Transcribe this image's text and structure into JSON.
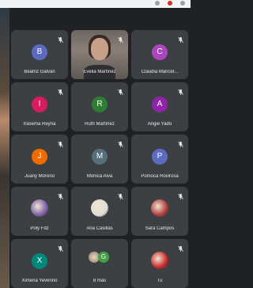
{
  "participants": [
    {
      "name": "Beatriz Galvan",
      "initial": "B",
      "color": "#5c6bc0",
      "muted": true,
      "kind": "letter"
    },
    {
      "name": "Evelia Martínez",
      "initial": "",
      "color": "",
      "muted": true,
      "kind": "video"
    },
    {
      "name": "Claudia Maricel...",
      "initial": "C",
      "color": "#ab47bc",
      "muted": true,
      "kind": "letter"
    },
    {
      "name": "Irasema Reyna",
      "initial": "I",
      "color": "#d81b60",
      "muted": true,
      "kind": "letter"
    },
    {
      "name": "Ruth Martínez",
      "initial": "R",
      "color": "#2e7d32",
      "muted": true,
      "kind": "letter"
    },
    {
      "name": "Angie Yado",
      "initial": "A",
      "color": "#8e24aa",
      "muted": true,
      "kind": "letter"
    },
    {
      "name": "Juany Moreno",
      "initial": "J",
      "color": "#ef6c00",
      "muted": true,
      "kind": "letter"
    },
    {
      "name": "Monica Alva",
      "initial": "M",
      "color": "#546e7a",
      "muted": true,
      "kind": "letter"
    },
    {
      "name": "Pomoca Rovirosa",
      "initial": "P",
      "color": "#5c6bc0",
      "muted": true,
      "kind": "letter"
    },
    {
      "name": "Poly Fdz",
      "initial": "",
      "color": "#7b5ea7",
      "muted": true,
      "kind": "image"
    },
    {
      "name": "Ana Casillas",
      "initial": "",
      "color": "#e0ddd5",
      "muted": true,
      "kind": "image"
    },
    {
      "name": "Sara Campos",
      "initial": "",
      "color": "#b23a3a",
      "muted": true,
      "kind": "image"
    },
    {
      "name": "Ximena Yeverino",
      "initial": "X",
      "color": "#00897b",
      "muted": true,
      "kind": "letter"
    },
    {
      "name": "8 más",
      "initial": "G",
      "color": "#43a047",
      "muted": false,
      "kind": "more"
    },
    {
      "name": "Tú",
      "initial": "",
      "color": "#c62828",
      "muted": true,
      "kind": "image"
    }
  ]
}
